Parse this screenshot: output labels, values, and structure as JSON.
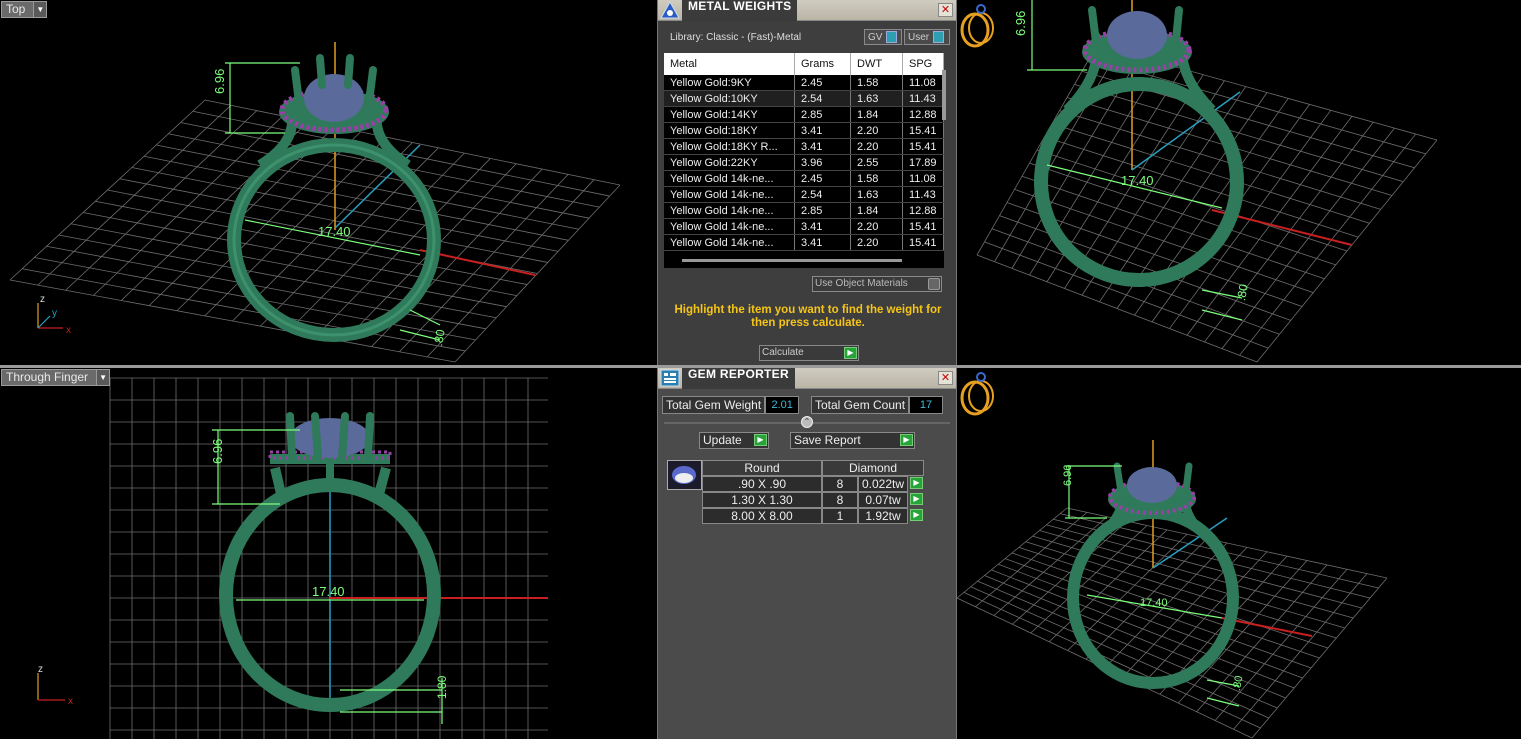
{
  "viewports": {
    "top_left": {
      "label": "Top",
      "dim_height": "6.96",
      "dim_width": "17.40",
      "dim_band": ".80",
      "axes": [
        "z",
        "y",
        "x"
      ]
    },
    "top_right": {
      "dim_height": "6.96",
      "dim_width": "17.40",
      "dim_band": ".80"
    },
    "bottom_left": {
      "label": "Through Finger",
      "dim_height": "6.96",
      "dim_width": "17.40",
      "dim_band": "1.80",
      "axes": [
        "z",
        "x"
      ]
    },
    "bottom_right": {
      "dim_height": "6.96",
      "dim_width": "17.40",
      "dim_band": ".80"
    }
  },
  "metal_weights": {
    "title": "METAL WEIGHTS",
    "library": "Library: Classic - (Fast)-Metal",
    "toggle_gv": "GV",
    "toggle_user": "User",
    "columns": [
      "Metal",
      "Grams",
      "DWT",
      "SPG"
    ],
    "rows": [
      [
        "Yellow Gold:9KY",
        "2.45",
        "1.58",
        "11.08"
      ],
      [
        "Yellow Gold:10KY",
        "2.54",
        "1.63",
        "11.43"
      ],
      [
        "Yellow Gold:14KY",
        "2.85",
        "1.84",
        "12.88"
      ],
      [
        "Yellow Gold:18KY",
        "3.41",
        "2.20",
        "15.41"
      ],
      [
        "Yellow Gold:18KY R...",
        "3.41",
        "2.20",
        "15.41"
      ],
      [
        "Yellow Gold:22KY",
        "3.96",
        "2.55",
        "17.89"
      ],
      [
        "Yellow Gold 14k-ne...",
        "2.45",
        "1.58",
        "11.08"
      ],
      [
        "Yellow Gold 14k-ne...",
        "2.54",
        "1.63",
        "11.43"
      ],
      [
        "Yellow Gold 14k-ne...",
        "2.85",
        "1.84",
        "12.88"
      ],
      [
        "Yellow Gold 14k-ne...",
        "3.41",
        "2.20",
        "15.41"
      ],
      [
        "Yellow Gold 14k-ne...",
        "3.41",
        "2.20",
        "15.41"
      ]
    ],
    "use_object_materials": "Use Object Materials",
    "hint": "Highlight the item you want to find the weight for then press calculate.",
    "calculate": "Calculate"
  },
  "gem_reporter": {
    "title": "GEM REPORTER",
    "total_weight_label": "Total Gem Weight",
    "total_weight": "2.01",
    "total_count_label": "Total Gem Count",
    "total_count": "17",
    "update": "Update",
    "save_report": "Save Report",
    "columns": [
      "Round",
      "Diamond"
    ],
    "rows": [
      [
        ".90 X .90",
        "8",
        "0.022tw"
      ],
      [
        "1.30 X 1.30",
        "8",
        "0.07tw"
      ],
      [
        "8.00 X 8.00",
        "1",
        "1.92tw"
      ]
    ]
  },
  "colors": {
    "ring": "#2f7a5a",
    "stone": "#5a6a9a",
    "accent_gems": "#9b3fa8",
    "grid": "#777777",
    "dimension": "#7cff7c",
    "axis_y": "#e0a020",
    "axis_x": "#c82020",
    "axis_other": "#2a9fc0",
    "hint_text": "#f5c518",
    "value_text": "#3fb9d6"
  }
}
